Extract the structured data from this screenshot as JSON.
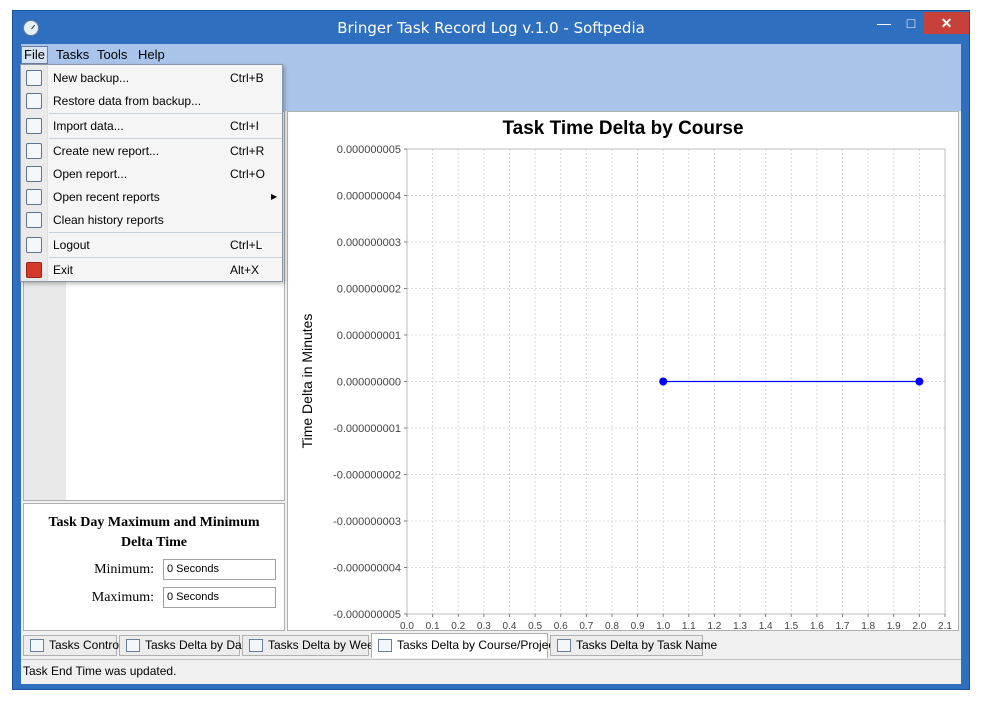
{
  "window": {
    "title": "Bringer Task Record Log v.1.0  - Softpedia"
  },
  "menubar": {
    "items": [
      "File",
      "Tasks",
      "Tools",
      "Help"
    ]
  },
  "file_menu": {
    "items": [
      {
        "label": "New backup...",
        "shortcut": "Ctrl+B",
        "icon": "backup-icon"
      },
      {
        "label": "Restore data from backup...",
        "shortcut": "",
        "icon": "restore-icon"
      },
      {
        "label": "Import data...",
        "shortcut": "Ctrl+I",
        "icon": "import-icon"
      },
      {
        "label": "Create new report...",
        "shortcut": "Ctrl+R",
        "icon": "new-report-icon"
      },
      {
        "label": "Open report...",
        "shortcut": "Ctrl+O",
        "icon": "open-report-icon"
      },
      {
        "label": "Open recent reports",
        "shortcut": "",
        "icon": "recent-reports-icon"
      },
      {
        "label": "Clean history reports",
        "shortcut": "",
        "icon": "clean-history-icon"
      },
      {
        "label": "Logout",
        "shortcut": "Ctrl+L",
        "icon": "logout-icon"
      },
      {
        "label": "Exit",
        "shortcut": "Alt+X",
        "icon": "power-icon"
      }
    ]
  },
  "stats": {
    "title_line1": "Task Day Maximum and Minimum",
    "title_line2": "Delta Time",
    "minimum_label": "Minimum:",
    "minimum_value": "0 Seconds",
    "maximum_label": "Maximum:",
    "maximum_value": "0 Seconds"
  },
  "chart_data": {
    "type": "line",
    "title": "Task Time Delta by Course",
    "xlabel": "",
    "ylabel": "Time Delta in Minutes",
    "x": [
      1.0,
      2.0
    ],
    "series": [
      {
        "values": [
          0.0,
          0.0
        ]
      }
    ],
    "xlim": [
      0.0,
      2.1
    ],
    "ylim": [
      -5e-09,
      5e-09
    ],
    "x_ticks": [
      "0.0",
      "0.1",
      "0.2",
      "0.3",
      "0.4",
      "0.5",
      "0.6",
      "0.7",
      "0.8",
      "0.9",
      "1.0",
      "1.1",
      "1.2",
      "1.3",
      "1.4",
      "1.5",
      "1.6",
      "1.7",
      "1.8",
      "1.9",
      "2.0",
      "2.1"
    ],
    "y_ticks": [
      "0.000000005",
      "0.000000004",
      "0.000000003",
      "0.000000002",
      "0.000000001",
      "0.000000000",
      "-0.000000001",
      "-0.000000002",
      "-0.000000003",
      "-0.000000004",
      "-0.000000005"
    ],
    "grid": true,
    "colors": {
      "series": "#0000ff",
      "grid": "#d8d8d8"
    }
  },
  "tabs": [
    {
      "label": "Tasks Control",
      "icon": "calendar-icon",
      "active": false
    },
    {
      "label": "Tasks Delta by Day",
      "icon": "day-calendar-icon",
      "active": false
    },
    {
      "label": "Tasks Delta by Week",
      "icon": "week-calendar-icon",
      "active": false
    },
    {
      "label": "Tasks Delta by Course/Project",
      "icon": "grid-icon",
      "active": true
    },
    {
      "label": "Tasks Delta by Task Name",
      "icon": "task-list-icon",
      "active": false
    }
  ],
  "status": {
    "text": "Task End Time was updated."
  },
  "colors": {
    "title_bar": "#2e6fbf",
    "menubar": "#a9c4eb",
    "close_button": "#c7403a"
  }
}
